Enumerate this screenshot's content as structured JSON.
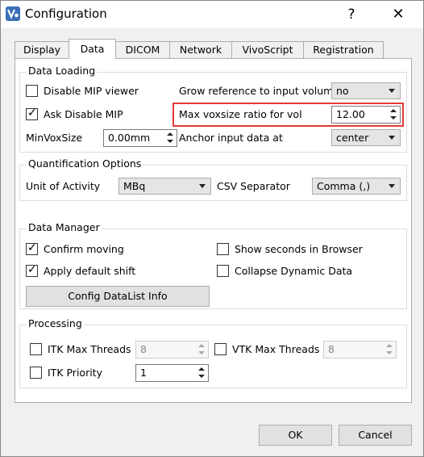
{
  "window": {
    "title": "Configuration",
    "help_glyph": "?",
    "close_glyph": "✕"
  },
  "tabs": [
    {
      "label": "Display"
    },
    {
      "label": "Data"
    },
    {
      "label": "DICOM"
    },
    {
      "label": "Network"
    },
    {
      "label": "VivoScript"
    },
    {
      "label": "Registration"
    }
  ],
  "data_loading": {
    "title": "Data Loading",
    "disable_mip_viewer": {
      "label": "Disable MIP viewer",
      "checked": false
    },
    "ask_disable_mip": {
      "label": "Ask Disable MIP",
      "checked": true
    },
    "min_vox_size": {
      "label": "MinVoxSize",
      "value": "0.00mm"
    },
    "grow_reference": {
      "label": "Grow reference to input volume",
      "value": "no"
    },
    "max_voxsize_ratio": {
      "label": "Max voxsize ratio for vol",
      "value": "12.00"
    },
    "anchor_input": {
      "label": "Anchor input data at",
      "value": "center"
    }
  },
  "quantification": {
    "title": "Quantification Options",
    "unit_of_activity": {
      "label": "Unit of Activity",
      "value": "MBq"
    },
    "csv_separator": {
      "label": "CSV Separator",
      "value": "Comma (,)"
    }
  },
  "data_manager": {
    "title": "Data Manager",
    "confirm_moving": {
      "label": "Confirm moving",
      "checked": true
    },
    "apply_default_shift": {
      "label": "Apply default shift",
      "checked": true
    },
    "show_seconds": {
      "label": "Show seconds in Browser",
      "checked": false
    },
    "collapse_dynamic": {
      "label": "Collapse Dynamic Data",
      "checked": false
    },
    "config_datalist_button": "Config DataList Info"
  },
  "processing": {
    "title": "Processing",
    "itk_max_threads": {
      "label": "ITK Max Threads",
      "checked": false,
      "value": "8"
    },
    "vtk_max_threads": {
      "label": "VTK Max Threads",
      "checked": false,
      "value": "8"
    },
    "itk_priority": {
      "label": "ITK Priority",
      "checked": false,
      "value": "1"
    }
  },
  "footer": {
    "ok_label": "OK",
    "cancel_label": "Cancel"
  },
  "colors": {
    "highlight": "#e53935",
    "app_icon": "#3a6fb7"
  },
  "check_glyph": "✓"
}
